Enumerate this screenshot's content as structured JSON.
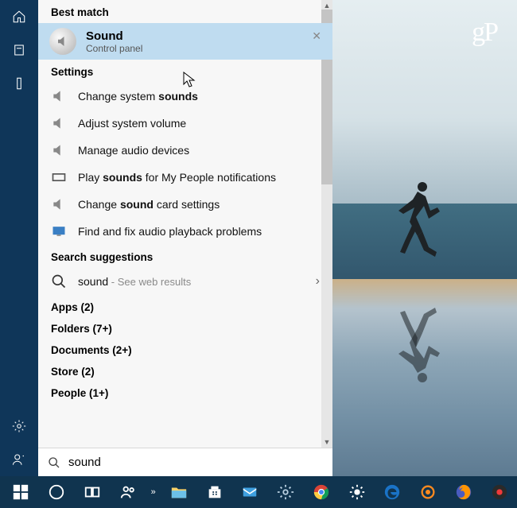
{
  "watermark": "gP",
  "search": {
    "query": "sound",
    "best_match_header": "Best match",
    "best_match": {
      "title": "Sound",
      "subtitle": "Control panel"
    },
    "settings_header": "Settings",
    "settings": [
      {
        "pre": "Change system ",
        "bold": "sounds",
        "post": ""
      },
      {
        "pre": "Adjust system volume",
        "bold": "",
        "post": ""
      },
      {
        "pre": "Manage audio devices",
        "bold": "",
        "post": ""
      },
      {
        "pre": "Play ",
        "bold": "sounds",
        "post": " for My People notifications"
      },
      {
        "pre": "Change ",
        "bold": "sound",
        "post": " card settings"
      },
      {
        "pre": "Find and fix audio playback problems",
        "bold": "",
        "post": ""
      }
    ],
    "suggestions_header": "Search suggestions",
    "suggestion": {
      "term": "sound",
      "hint": " - See web results"
    },
    "categories": [
      "Apps (2)",
      "Folders (7+)",
      "Documents (2+)",
      "Store (2)",
      "People (1+)"
    ]
  }
}
